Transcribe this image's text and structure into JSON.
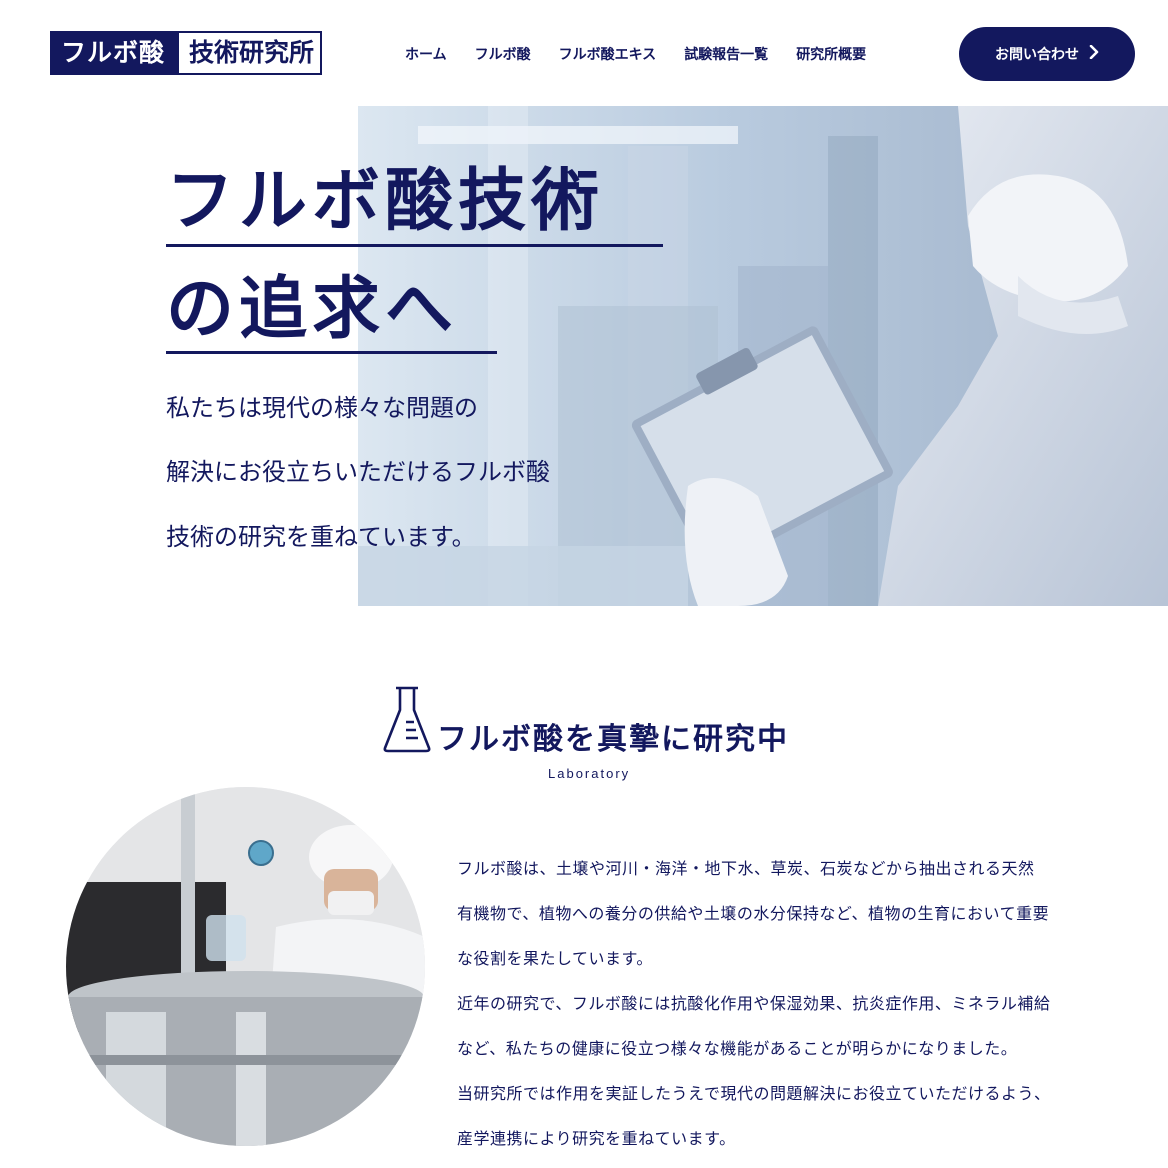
{
  "header": {
    "logo_left": "フルボ酸",
    "logo_right": "技術研究所",
    "nav": [
      "ホーム",
      "フルボ酸",
      "フルボ酸エキス",
      "試験報告一覧",
      "研究所概要"
    ],
    "contact_label": "お問い合わせ",
    "contact_icon": "chevron-right-icon"
  },
  "hero": {
    "title_line1": "フルボ酸技術",
    "title_line2": "の追求へ",
    "desc": [
      "私たちは現代の様々な問題の",
      "解決にお役立ちいただけるフルボ酸",
      "技術の研究を重ねています。"
    ]
  },
  "section": {
    "title": "フルボ酸を真摯に研究中",
    "subtitle": "Laboratory",
    "icon": "flask-icon",
    "paragraphs": [
      "フルボ酸は、土壌や河川・海洋・地下水、草炭、石炭などから抽出される天然",
      "有機物で、植物への養分の供給や土壌の水分保持など、植物の生育において重要",
      "な役割を果たしています。",
      "近年の研究で、フルボ酸には抗酸化作用や保湿効果、抗炎症作用、ミネラル補給",
      "など、私たちの健康に役立つ様々な機能があることが明らかになりました。",
      "当研究所では作用を実証したうえで現代の問題解決にお役立ていただけるよう、",
      "産学連携により研究を重ねています。"
    ]
  },
  "colors": {
    "primary": "#13185e",
    "background": "#ffffff"
  }
}
